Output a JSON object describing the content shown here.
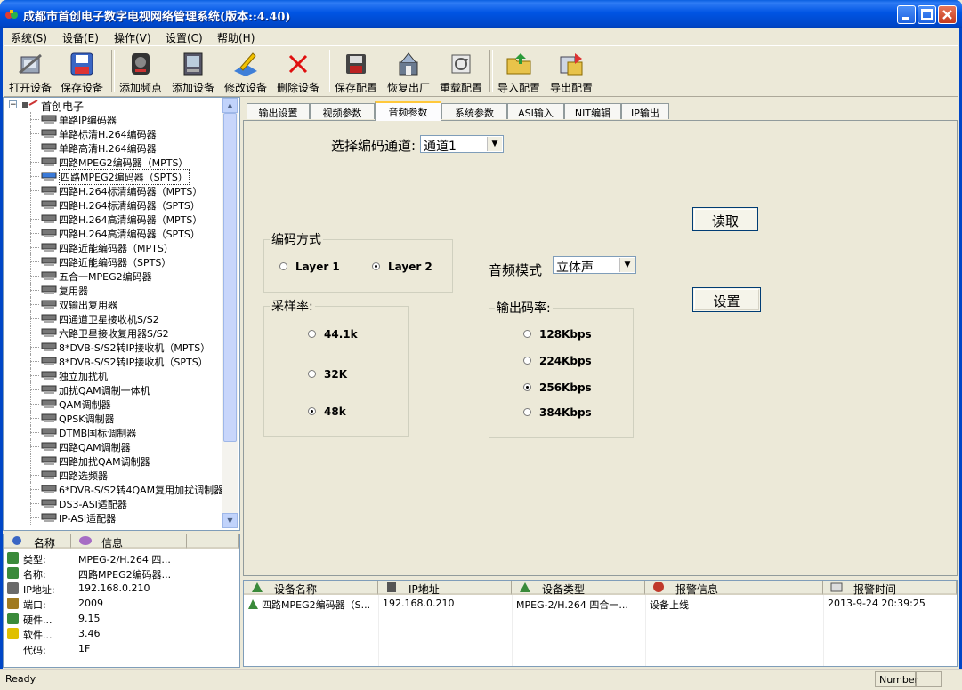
{
  "window": {
    "title": "成都市首创电子数字电视网络管理系统(版本::4.40)"
  },
  "menu": [
    "系统(S)",
    "设备(E)",
    "操作(V)",
    "设置(C)",
    "帮助(H)"
  ],
  "toolbar": [
    {
      "label": "打开设备",
      "icon": "open-device-icon"
    },
    {
      "label": "保存设备",
      "icon": "save-device-icon"
    },
    {
      "label": "添加频点",
      "icon": "add-frequency-icon"
    },
    {
      "label": "添加设备",
      "icon": "add-device-icon"
    },
    {
      "label": "修改设备",
      "icon": "edit-device-icon"
    },
    {
      "label": "删除设备",
      "icon": "delete-device-icon"
    },
    {
      "label": "保存配置",
      "icon": "save-config-icon"
    },
    {
      "label": "恢复出厂",
      "icon": "factory-reset-icon"
    },
    {
      "label": "重载配置",
      "icon": "reload-config-icon"
    },
    {
      "label": "导入配置",
      "icon": "import-config-icon"
    },
    {
      "label": "导出配置",
      "icon": "export-config-icon"
    }
  ],
  "tree": {
    "root": "首创电子",
    "items": [
      "单路IP编码器",
      "单路标清H.264编码器",
      "单路高清H.264编码器",
      "四路MPEG2编码器（MPTS）",
      "四路MPEG2编码器（SPTS）",
      "四路H.264标清编码器（MPTS）",
      "四路H.264标清编码器（SPTS）",
      "四路H.264高清编码器（MPTS）",
      "四路H.264高清编码器（SPTS）",
      "四路近能编码器（MPTS）",
      "四路近能编码器（SPTS）",
      "五合一MPEG2编码器",
      "复用器",
      "双输出复用器",
      "四通道卫星接收机S/S2",
      "六路卫星接收复用器S/S2",
      "8*DVB-S/S2转IP接收机（MPTS）",
      "8*DVB-S/S2转IP接收机（SPTS）",
      "独立加扰机",
      "加扰QAM调制一体机",
      "QAM调制器",
      "QPSK调制器",
      "DTMB国标调制器",
      "四路QAM调制器",
      "四路加扰QAM调制器",
      "四路选频器",
      "6*DVB-S/S2转4QAM复用加扰调制器",
      "DS3-ASI适配器",
      "IP-ASI适配器"
    ],
    "selected_index": 4
  },
  "info": {
    "headers": [
      "名称",
      "信息"
    ],
    "rows": [
      {
        "key": "类型:",
        "value": "MPEG-2/H.264 四..."
      },
      {
        "key": "名称:",
        "value": "四路MPEG2编码器..."
      },
      {
        "key": "IP地址:",
        "value": "192.168.0.210"
      },
      {
        "key": "端口:",
        "value": "2009"
      },
      {
        "key": "硬件...",
        "value": "9.15"
      },
      {
        "key": "软件...",
        "value": "3.46"
      },
      {
        "key": "代码:",
        "value": "1F"
      }
    ]
  },
  "tabs": [
    "输出设置",
    "视频参数",
    "音频参数",
    "系统参数",
    "ASI输入",
    "NIT编辑",
    "IP输出"
  ],
  "active_tab": 2,
  "audio": {
    "channel_label": "选择编码通道:",
    "channel_value": "通道1",
    "read_button": "读取",
    "set_button": "设置",
    "encode_group": "编码方式",
    "encode_options": [
      "Layer 1",
      "Layer 2"
    ],
    "encode_selected": 1,
    "mode_label": "音频模式",
    "mode_value": "立体声",
    "sample_group": "采样率:",
    "sample_options": [
      "44.1k",
      "32K",
      "48k"
    ],
    "sample_selected": 2,
    "bitrate_group": "输出码率:",
    "bitrate_options": [
      "128Kbps",
      "224Kbps",
      "256Kbps",
      "384Kbps"
    ],
    "bitrate_selected": 2
  },
  "alarm": {
    "headers": [
      "设备名称",
      "IP地址",
      "设备类型",
      "报警信息",
      "报警时间"
    ],
    "rows": [
      [
        "四路MPEG2编码器（S...",
        "192.168.0.210",
        "MPEG-2/H.264 四合一...",
        "设备上线",
        "2013-9-24 20:39:25"
      ]
    ]
  },
  "status": {
    "left": "Ready",
    "right": "Number"
  }
}
